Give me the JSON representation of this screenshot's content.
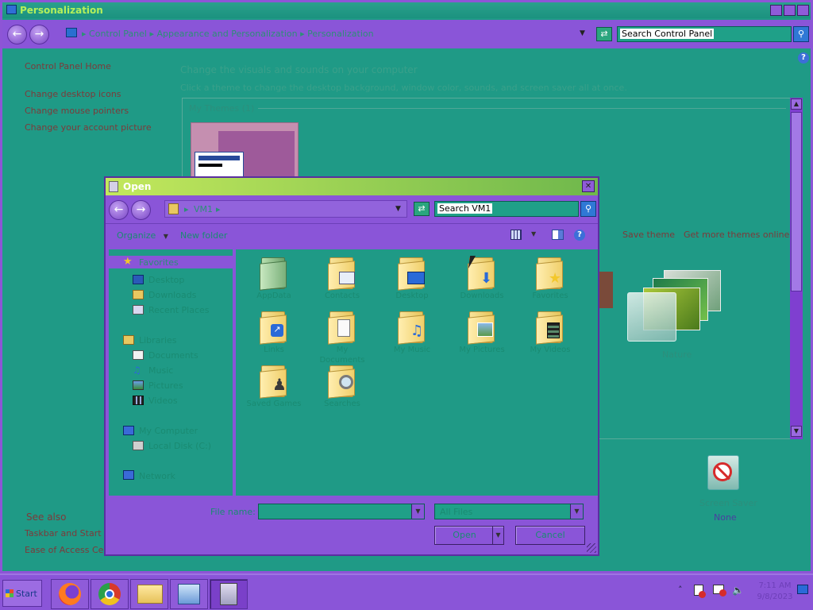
{
  "main_window": {
    "title": "Personalization",
    "breadcrumb": [
      "Control Panel",
      "Appearance and Personalization",
      "Personalization"
    ],
    "search_placeholder": "Search Control Panel",
    "sidebar": {
      "home": "Control Panel Home",
      "tasks": [
        "Change desktop icons",
        "Change mouse pointers",
        "Change your account picture"
      ],
      "see_also_heading": "See also",
      "see_also": [
        "Taskbar and Start Menu",
        "Ease of Access Center"
      ]
    },
    "heading": "Change the visuals and sounds on your computer",
    "subheading": "Click a theme to change the desktop background, window color, sounds, and screen saver all at once.",
    "my_themes_label": "My Themes (1)",
    "theme_links": [
      "Save theme",
      "Get more themes online"
    ],
    "theme_nature_label": "Nature",
    "screen_saver_label": "Screen Saver",
    "screen_saver_value": "None"
  },
  "dialog": {
    "title": "Open",
    "location": "VM1",
    "search_placeholder": "Search VM1",
    "toolbar": {
      "organize": "Organize",
      "new_folder": "New folder"
    },
    "nav": {
      "favorites": "Favorites",
      "favorites_items": [
        "Desktop",
        "Downloads",
        "Recent Places"
      ],
      "libraries": "Libraries",
      "libraries_items": [
        "Documents",
        "Music",
        "Pictures",
        "Videos"
      ],
      "computer": "My Computer",
      "computer_items": [
        "Local Disk (C:)"
      ],
      "network": "Network"
    },
    "folders": [
      "AppData",
      "Contacts",
      "Desktop",
      "Downloads",
      "Favorites",
      "Links",
      "My Documents",
      "My Music",
      "My Pictures",
      "My Videos",
      "Saved Games",
      "Searches"
    ],
    "file_name_label": "File name:",
    "file_name_value": "",
    "file_type_value": "All Files",
    "open_label": "Open",
    "cancel_label": "Cancel"
  },
  "taskbar": {
    "start_label": "Start",
    "apps": [
      "firefox",
      "chrome",
      "explorer",
      "control-panel",
      "file-dialog"
    ],
    "clock_time": "7:11 AM",
    "clock_date": "9/8/2023"
  }
}
